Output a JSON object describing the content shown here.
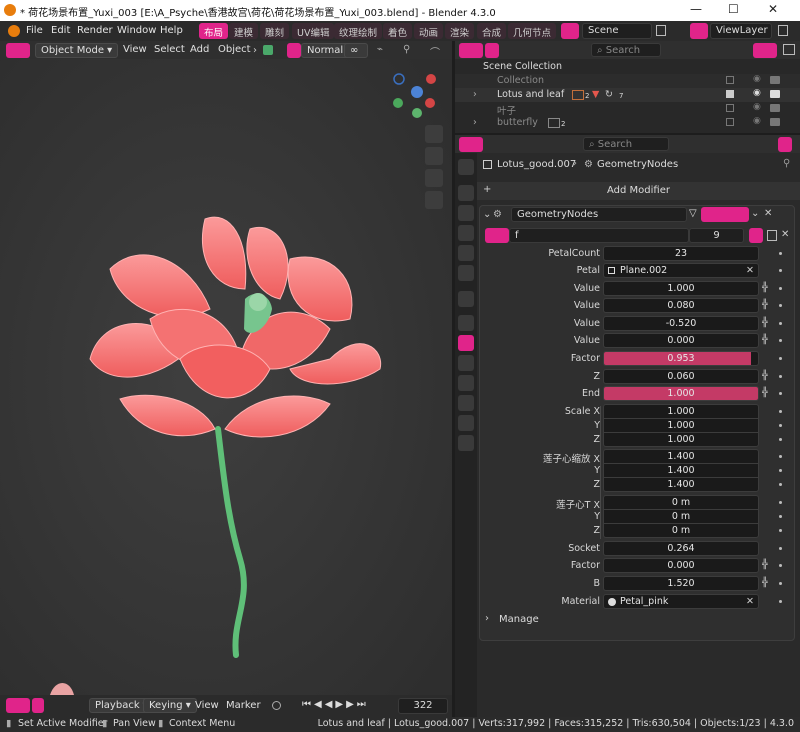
{
  "window": {
    "title": "* 荷花场景布置_Yuxi_003 [E:\\A_Psyche\\香港故宫\\荷花\\荷花场景布置_Yuxi_003.blend] - Blender 4.3.0",
    "minimize": "—",
    "maximize": "☐",
    "close": "✕"
  },
  "menubar": {
    "items": [
      "File",
      "Edit",
      "Render",
      "Window",
      "Help"
    ],
    "workspaces": [
      "布局",
      "建模",
      "雕刻",
      "UV编辑",
      "纹理绘制",
      "着色",
      "动画",
      "渲染",
      "合成",
      "几何节点"
    ],
    "active_workspace": "布局",
    "scene": "Scene",
    "view_layer": "ViewLayer"
  },
  "viewport_header": {
    "mode": "Object Mode",
    "menus": [
      "View",
      "Select",
      "Add",
      "Object"
    ],
    "transform": "Normal"
  },
  "timeline": {
    "playback": "Playback",
    "keying": "Keying",
    "view": "View",
    "marker": "Marker",
    "frame": "322"
  },
  "outliner": {
    "search_placeholder": "Search",
    "rows": [
      {
        "label": "Scene Collection"
      },
      {
        "label": "Collection"
      },
      {
        "label": "Lotus and leaf",
        "counts": [
          "2",
          "7"
        ]
      },
      {
        "label": "叶子"
      },
      {
        "label": "butterfly",
        "counts": [
          "2"
        ]
      }
    ]
  },
  "properties": {
    "search_placeholder": "Search",
    "breadcrumb_object": "Lotus_good.007",
    "breadcrumb_modifier": "GeometryNodes",
    "add_modifier": "Add Modifier",
    "modifier_name": "GeometryNodes",
    "node_group": "f",
    "node_group_users": "9",
    "manage": "Manage",
    "params": [
      {
        "label": "PetalCount",
        "value": "23",
        "type": "int"
      },
      {
        "label": "Petal",
        "value": "Plane.002",
        "type": "object"
      },
      {
        "label": "Value",
        "value": "1.000",
        "type": "float"
      },
      {
        "label": "Value",
        "value": "0.080",
        "type": "float"
      },
      {
        "label": "Value",
        "value": "-0.520",
        "type": "float"
      },
      {
        "label": "Value",
        "value": "0.000",
        "type": "float"
      },
      {
        "label": "Factor",
        "value": "0.953",
        "type": "factor",
        "fill": 0.953
      },
      {
        "label": "Z",
        "value": "0.060",
        "type": "float"
      },
      {
        "label": "End",
        "value": "1.000",
        "type": "factor",
        "fill": 1.0
      },
      {
        "label": "Scale X",
        "value": "1.000",
        "type": "vec"
      },
      {
        "label": "Y",
        "value": "1.000",
        "type": "vec"
      },
      {
        "label": "Z",
        "value": "1.000",
        "type": "vec"
      },
      {
        "label": "莲子心缩放 X",
        "value": "1.400",
        "type": "vec"
      },
      {
        "label": "Y",
        "value": "1.400",
        "type": "vec"
      },
      {
        "label": "Z",
        "value": "1.400",
        "type": "vec"
      },
      {
        "label": "莲子心T X",
        "value": "0 m",
        "type": "vec"
      },
      {
        "label": "Y",
        "value": "0 m",
        "type": "vec"
      },
      {
        "label": "Z",
        "value": "0 m",
        "type": "vec"
      },
      {
        "label": "Socket",
        "value": "0.264",
        "type": "float"
      },
      {
        "label": "Factor",
        "value": "0.000",
        "type": "float"
      },
      {
        "label": "B",
        "value": "1.520",
        "type": "float"
      },
      {
        "label": "Material",
        "value": "Petal_pink",
        "type": "material"
      }
    ]
  },
  "statusbar": {
    "left": [
      "Set Active Modifier",
      "Pan View",
      "Context Menu"
    ],
    "right": "Lotus and leaf | Lotus_good.007 | Verts:317,992 | Faces:315,252 | Tris:630,504 | Objects:1/23 | 4.3.0"
  },
  "colors": {
    "accent": "#e0248a",
    "factor_fill": "#c43a66",
    "petal": "#f26a6a",
    "stem": "#5fbf78"
  }
}
